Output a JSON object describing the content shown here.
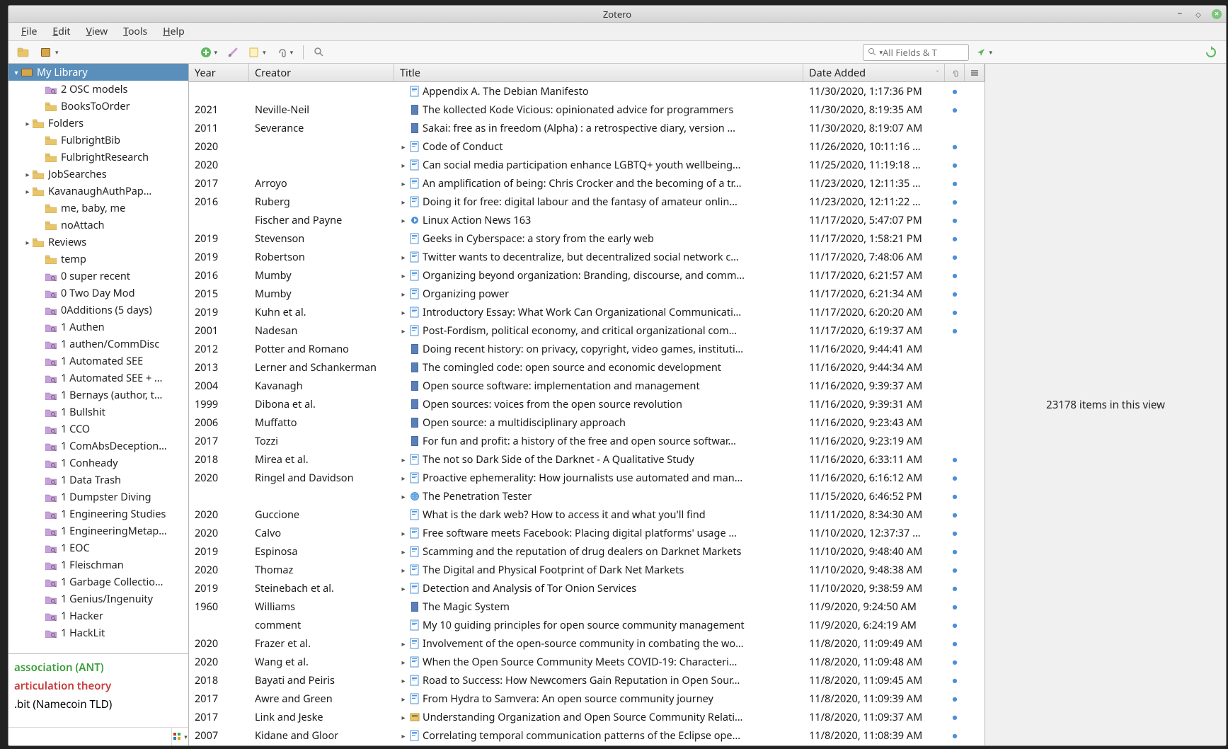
{
  "window": {
    "title": "Zotero"
  },
  "menu": {
    "items": [
      "File",
      "Edit",
      "View",
      "Tools",
      "Help"
    ]
  },
  "toolbar": {
    "search_placeholder": "All Fields & T"
  },
  "sidebar": {
    "library_label": "My Library",
    "folders": [
      {
        "label": "2 OSC models",
        "kind": "saved",
        "indent": 2,
        "expand": ""
      },
      {
        "label": "BooksToOrder",
        "kind": "folder",
        "indent": 2,
        "expand": ""
      },
      {
        "label": "Folders",
        "kind": "folder",
        "indent": 1,
        "expand": "▸"
      },
      {
        "label": "FulbrightBib",
        "kind": "folder",
        "indent": 2,
        "expand": ""
      },
      {
        "label": "FulbrightResearch",
        "kind": "folder",
        "indent": 2,
        "expand": ""
      },
      {
        "label": "JobSearches",
        "kind": "folder",
        "indent": 1,
        "expand": "▸"
      },
      {
        "label": "KavanaughAuthPap…",
        "kind": "folder",
        "indent": 1,
        "expand": "▸"
      },
      {
        "label": "me, baby, me",
        "kind": "folder",
        "indent": 2,
        "expand": ""
      },
      {
        "label": "noAttach",
        "kind": "folder",
        "indent": 2,
        "expand": ""
      },
      {
        "label": "Reviews",
        "kind": "folder",
        "indent": 1,
        "expand": "▸"
      },
      {
        "label": "temp",
        "kind": "folder",
        "indent": 2,
        "expand": ""
      },
      {
        "label": "0 super recent",
        "kind": "saved",
        "indent": 2,
        "expand": ""
      },
      {
        "label": "0 Two Day Mod",
        "kind": "saved",
        "indent": 2,
        "expand": ""
      },
      {
        "label": "0Additions (5 days)",
        "kind": "saved",
        "indent": 2,
        "expand": ""
      },
      {
        "label": "1 Authen",
        "kind": "saved",
        "indent": 2,
        "expand": ""
      },
      {
        "label": "1 authen/CommDisc",
        "kind": "saved",
        "indent": 2,
        "expand": ""
      },
      {
        "label": "1 Automated SEE",
        "kind": "saved",
        "indent": 2,
        "expand": ""
      },
      {
        "label": "1 Automated SEE + …",
        "kind": "saved",
        "indent": 2,
        "expand": ""
      },
      {
        "label": "1 Bernays (author, t…",
        "kind": "saved",
        "indent": 2,
        "expand": ""
      },
      {
        "label": "1 Bullshit",
        "kind": "saved",
        "indent": 2,
        "expand": ""
      },
      {
        "label": "1 CCO",
        "kind": "saved",
        "indent": 2,
        "expand": ""
      },
      {
        "label": "1 ComAbsDeception…",
        "kind": "saved",
        "indent": 2,
        "expand": ""
      },
      {
        "label": "1 Conheady",
        "kind": "saved",
        "indent": 2,
        "expand": ""
      },
      {
        "label": "1 Data Trash",
        "kind": "saved",
        "indent": 2,
        "expand": ""
      },
      {
        "label": "1 Dumpster Diving",
        "kind": "saved",
        "indent": 2,
        "expand": ""
      },
      {
        "label": "1 Engineering Studies",
        "kind": "saved",
        "indent": 2,
        "expand": ""
      },
      {
        "label": "1 EngineeringMetap…",
        "kind": "saved",
        "indent": 2,
        "expand": ""
      },
      {
        "label": "1 EOC",
        "kind": "saved",
        "indent": 2,
        "expand": ""
      },
      {
        "label": "1 Fleischman",
        "kind": "saved",
        "indent": 2,
        "expand": ""
      },
      {
        "label": "1 Garbage Collectio…",
        "kind": "saved",
        "indent": 2,
        "expand": ""
      },
      {
        "label": "1 Genius/Ingenuity",
        "kind": "saved",
        "indent": 2,
        "expand": ""
      },
      {
        "label": "1 Hacker",
        "kind": "saved",
        "indent": 2,
        "expand": ""
      },
      {
        "label": "1 HackLit",
        "kind": "saved",
        "indent": 2,
        "expand": ""
      }
    ]
  },
  "tags": {
    "items": [
      {
        "label": "association (ANT)",
        "cls": "green"
      },
      {
        "label": "articulation theory",
        "cls": "red"
      },
      {
        "label": ".bit (Namecoin TLD)",
        "cls": ""
      }
    ]
  },
  "columns": {
    "year": "Year",
    "creator": "Creator",
    "title": "Title",
    "date": "Date Added"
  },
  "items": [
    {
      "year": "",
      "creator": "",
      "title": "Appendix A. The Debian Manifesto",
      "date": "11/30/2020, 1:17:36 PM",
      "expand": "",
      "icon": "page",
      "dot": "●"
    },
    {
      "year": "2021",
      "creator": "Neville-Neil",
      "title": "The kollected Kode Vicious: opinionated advice for programmers",
      "date": "11/30/2020, 8:19:35 AM",
      "expand": "",
      "icon": "book",
      "dot": "●"
    },
    {
      "year": "2011",
      "creator": "Severance",
      "title": "Sakai: free as in freedom (Alpha) : a retrospective diary, version …",
      "date": "11/30/2020, 8:19:07 AM",
      "expand": "",
      "icon": "book",
      "dot": ""
    },
    {
      "year": "2020",
      "creator": "",
      "title": "Code of Conduct",
      "date": "11/26/2020, 10:11:16 …",
      "expand": "▸",
      "icon": "page",
      "dot": "●"
    },
    {
      "year": "2020",
      "creator": "",
      "title": "Can social media participation enhance LGBTQ+ youth wellbeing…",
      "date": "11/25/2020, 11:19:18 …",
      "expand": "▸",
      "icon": "page",
      "dot": "●"
    },
    {
      "year": "2017",
      "creator": "Arroyo",
      "title": "An amplification of being: Chris Crocker and the becoming of a tr…",
      "date": "11/23/2020, 12:11:35 …",
      "expand": "▸",
      "icon": "page",
      "dot": "●"
    },
    {
      "year": "2016",
      "creator": "Ruberg",
      "title": "Doing it for free: digital labour and the fantasy of amateur onlin…",
      "date": "11/23/2020, 12:11:22 …",
      "expand": "▸",
      "icon": "page",
      "dot": "●"
    },
    {
      "year": "",
      "creator": "Fischer and Payne",
      "title": "Linux Action News 163",
      "date": "11/17/2020, 5:47:07 PM",
      "expand": "▸",
      "icon": "audio",
      "dot": "●"
    },
    {
      "year": "2019",
      "creator": "Stevenson",
      "title": "Geeks in Cyberspace: a story from the early web",
      "date": "11/17/2020, 1:58:21 PM",
      "expand": "",
      "icon": "page",
      "dot": "●"
    },
    {
      "year": "2019",
      "creator": "Robertson",
      "title": "Twitter wants to decentralize, but decentralized social network c…",
      "date": "11/17/2020, 7:48:06 AM",
      "expand": "▸",
      "icon": "page",
      "dot": "●"
    },
    {
      "year": "2016",
      "creator": "Mumby",
      "title": "Organizing beyond organization: Branding, discourse, and comm…",
      "date": "11/17/2020, 6:21:57 AM",
      "expand": "▸",
      "icon": "page",
      "dot": "●"
    },
    {
      "year": "2015",
      "creator": "Mumby",
      "title": "Organizing power",
      "date": "11/17/2020, 6:21:34 AM",
      "expand": "▸",
      "icon": "page",
      "dot": "●"
    },
    {
      "year": "2019",
      "creator": "Kuhn et al.",
      "title": "Introductory Essay: What Work Can Organizational Communicati…",
      "date": "11/17/2020, 6:20:20 AM",
      "expand": "▸",
      "icon": "page",
      "dot": "●"
    },
    {
      "year": "2001",
      "creator": "Nadesan",
      "title": "Post-Fordism, political economy, and critical organizational com…",
      "date": "11/17/2020, 6:19:37 AM",
      "expand": "▸",
      "icon": "page",
      "dot": "●"
    },
    {
      "year": "2012",
      "creator": "Potter and Romano",
      "title": "Doing recent history: on privacy, copyright, video games, instituti…",
      "date": "11/16/2020, 9:44:41 AM",
      "expand": "",
      "icon": "book",
      "dot": ""
    },
    {
      "year": "2013",
      "creator": "Lerner and Schankerman",
      "title": "The comingled code: open source and economic development",
      "date": "11/16/2020, 9:44:34 AM",
      "expand": "",
      "icon": "book",
      "dot": ""
    },
    {
      "year": "2004",
      "creator": "Kavanagh",
      "title": "Open source software: implementation and management",
      "date": "11/16/2020, 9:39:37 AM",
      "expand": "",
      "icon": "book",
      "dot": ""
    },
    {
      "year": "1999",
      "creator": "Dibona et al.",
      "title": "Open sources: voices from the open source revolution",
      "date": "11/16/2020, 9:39:31 AM",
      "expand": "",
      "icon": "book",
      "dot": ""
    },
    {
      "year": "2006",
      "creator": "Muffatto",
      "title": "Open source: a multidisciplinary approach",
      "date": "11/16/2020, 9:23:43 AM",
      "expand": "",
      "icon": "book",
      "dot": ""
    },
    {
      "year": "2017",
      "creator": "Tozzi",
      "title": "For fun and profit: a history of the free and open source softwar…",
      "date": "11/16/2020, 9:23:19 AM",
      "expand": "",
      "icon": "book",
      "dot": ""
    },
    {
      "year": "2018",
      "creator": "Mirea et al.",
      "title": "The not so Dark Side of the Darknet - A Qualitative Study",
      "date": "11/16/2020, 6:33:11 AM",
      "expand": "▸",
      "icon": "page",
      "dot": "●"
    },
    {
      "year": "2020",
      "creator": "Ringel and Davidson",
      "title": "Proactive ephemerality: How journalists use automated and man…",
      "date": "11/16/2020, 6:16:12 AM",
      "expand": "▸",
      "icon": "page",
      "dot": "●"
    },
    {
      "year": "",
      "creator": "",
      "title": "The Penetration Tester",
      "date": "11/15/2020, 6:46:52 PM",
      "expand": "▸",
      "icon": "web",
      "dot": "●"
    },
    {
      "year": "2020",
      "creator": "Guccione",
      "title": "What is the dark web? How to access it and what you'll find",
      "date": "11/11/2020, 8:34:30 AM",
      "expand": "",
      "icon": "page",
      "dot": "●"
    },
    {
      "year": "2020",
      "creator": "Calvo",
      "title": "Free software meets Facebook: Placing digital platforms' usage …",
      "date": "11/10/2020, 12:37:37 …",
      "expand": "▸",
      "icon": "page",
      "dot": "●"
    },
    {
      "year": "2019",
      "creator": "Espinosa",
      "title": "Scamming and the reputation of drug dealers on Darknet Markets",
      "date": "11/10/2020, 9:48:40 AM",
      "expand": "▸",
      "icon": "page",
      "dot": "●"
    },
    {
      "year": "2020",
      "creator": "Thomaz",
      "title": "The Digital and Physical Footprint of Dark Net Markets",
      "date": "11/10/2020, 9:48:38 AM",
      "expand": "▸",
      "icon": "page",
      "dot": "●"
    },
    {
      "year": "2019",
      "creator": "Steinebach et al.",
      "title": "Detection and Analysis of Tor Onion Services",
      "date": "11/10/2020, 9:38:59 AM",
      "expand": "▸",
      "icon": "page",
      "dot": "●"
    },
    {
      "year": "1960",
      "creator": "Williams",
      "title": "The Magic System",
      "date": "11/9/2020, 9:24:50 AM",
      "expand": "",
      "icon": "book",
      "dot": "●"
    },
    {
      "year": "",
      "creator": "comment",
      "title": "My 10 guiding principles for open source community management",
      "date": "11/9/2020, 6:24:19 AM",
      "expand": "",
      "icon": "page",
      "dot": "●"
    },
    {
      "year": "2020",
      "creator": "Frazer et al.",
      "title": "Involvement of the open-source community in combating the wo…",
      "date": "11/8/2020, 11:09:49 AM",
      "expand": "▸",
      "icon": "page",
      "dot": "●"
    },
    {
      "year": "2020",
      "creator": "Wang et al.",
      "title": "When the Open Source Community Meets COVID-19: Characteri…",
      "date": "11/8/2020, 11:09:48 AM",
      "expand": "▸",
      "icon": "page",
      "dot": "●"
    },
    {
      "year": "2018",
      "creator": "Bayati and Peiris",
      "title": "Road to Success: How Newcomers Gain Reputation in Open Sour…",
      "date": "11/8/2020, 11:09:45 AM",
      "expand": "▸",
      "icon": "page",
      "dot": "●"
    },
    {
      "year": "2017",
      "creator": "Awre and Green",
      "title": "From Hydra to Samvera: An open source community journey",
      "date": "11/8/2020, 11:09:39 AM",
      "expand": "▸",
      "icon": "page",
      "dot": "●"
    },
    {
      "year": "2017",
      "creator": "Link and Jeske",
      "title": "Understanding Organization and Open Source Community Relati…",
      "date": "11/8/2020, 11:09:37 AM",
      "expand": "▸",
      "icon": "conf",
      "dot": "●"
    },
    {
      "year": "2007",
      "creator": "Kidane and Gloor",
      "title": "Correlating temporal communication patterns of the Eclipse ope…",
      "date": "11/8/2020, 11:08:39 AM",
      "expand": "▸",
      "icon": "page",
      "dot": "●"
    }
  ],
  "rightpanel": {
    "summary": "23178 items in this view"
  }
}
